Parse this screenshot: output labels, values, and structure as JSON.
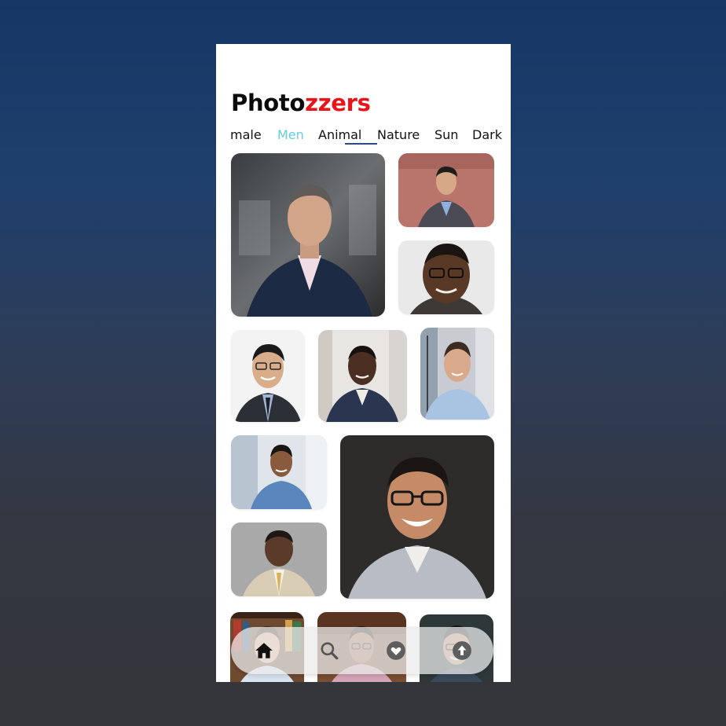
{
  "app": {
    "title_part1": "Photo",
    "title_part2": "zzers",
    "accent_color": "#e8131b",
    "active_tab_color": "#66ccdd"
  },
  "tabs": [
    {
      "label": "male"
    },
    {
      "label": "Men",
      "active": true
    },
    {
      "label": "Animal"
    },
    {
      "label": "Nature"
    },
    {
      "label": "Sun"
    },
    {
      "label": "Dark"
    }
  ],
  "gallery": {
    "photos": [
      {
        "subject": "man-in-navy-suit-portrait"
      },
      {
        "subject": "man-in-grey-blazer-brick-wall"
      },
      {
        "subject": "smiling-man-with-glasses"
      },
      {
        "subject": "man-with-glasses-in-suit"
      },
      {
        "subject": "man-in-navy-sweater"
      },
      {
        "subject": "man-in-light-blue-shirt-window"
      },
      {
        "subject": "man-in-blue-shirt-office"
      },
      {
        "subject": "man-in-beige-suit"
      },
      {
        "subject": "smiling-man-with-glasses-grey-shirt"
      },
      {
        "subject": "man-with-bookshelf"
      },
      {
        "subject": "man-in-pink-shirt"
      },
      {
        "subject": "man-with-glasses-smiling"
      }
    ]
  },
  "bottom_nav": {
    "items": [
      {
        "icon": "home-icon"
      },
      {
        "icon": "search-icon"
      },
      {
        "icon": "heart-icon"
      },
      {
        "icon": "upload-icon"
      }
    ]
  }
}
